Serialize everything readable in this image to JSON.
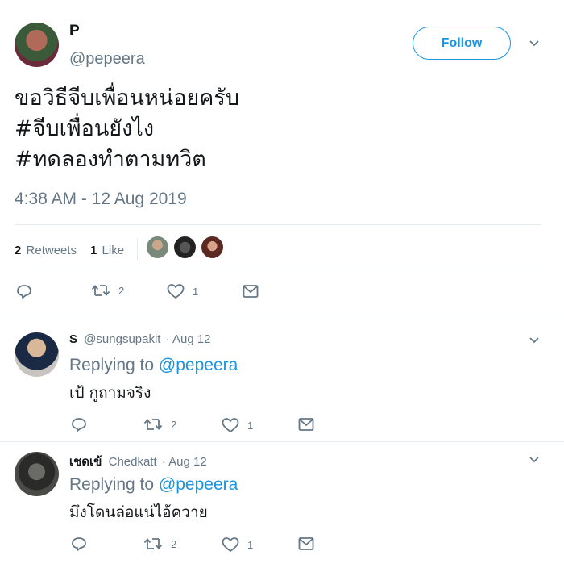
{
  "tweet": {
    "display_name": "P",
    "handle": "@pepeera",
    "follow_label": "Follow",
    "text_lines": [
      "ขอวิธีจีบเพื่อนหน่อยครับ",
      "#จีบเพื่อนยังไง",
      "#ทดลองทำตามทวิต"
    ],
    "timestamp": "4:38 AM - 12 Aug 2019",
    "retweets_count": "2",
    "retweets_label": "Retweets",
    "likes_count": "1",
    "likes_label": "Like",
    "actions": {
      "retweets": "2",
      "likes": "1"
    }
  },
  "replies": [
    {
      "name": "S",
      "handle": "@sungsupakit",
      "date": "· Aug 12",
      "replying_prefix": "Replying to",
      "replying_to": "@pepeera",
      "text": "เป้ กูถามจริง",
      "retweets": "2",
      "likes": "1"
    },
    {
      "name": "เชดเข้",
      "handle": "Chedkatt",
      "date": "· Aug 12",
      "replying_prefix": "Replying to",
      "replying_to": "@pepeera",
      "text": "มึงโดนล่อแน่ไอ้ควาย",
      "retweets": "2",
      "likes": "1"
    }
  ],
  "colors": {
    "accent": "#1b95e0",
    "muted": "#657786",
    "divider": "#e6ecf0"
  },
  "icons": [
    "reply-icon",
    "retweet-icon",
    "like-icon",
    "message-icon",
    "chevron-down-icon"
  ]
}
